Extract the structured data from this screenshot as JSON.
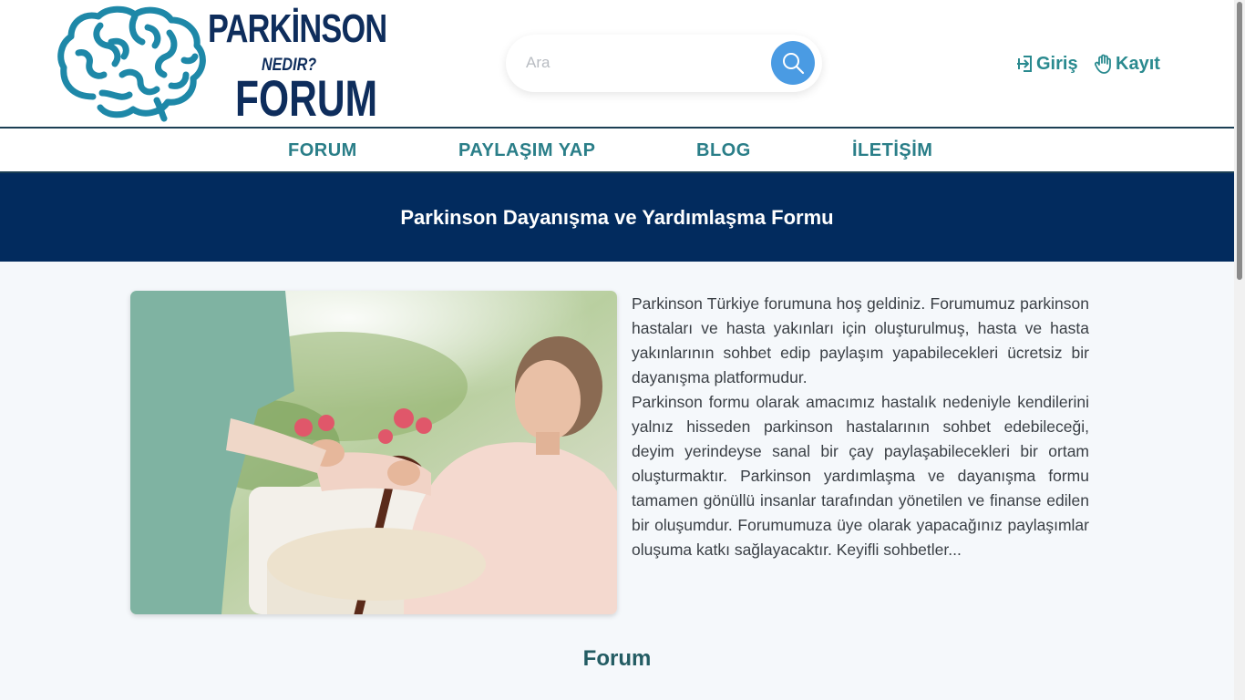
{
  "logo": {
    "line1": "PARKİNSON",
    "line2": "NEDIR?",
    "line3": "FORUM"
  },
  "search": {
    "placeholder": "Ara",
    "button_icon": "search-icon"
  },
  "auth": {
    "login_label": "Giriş",
    "register_label": "Kayıt"
  },
  "nav": {
    "items": [
      {
        "label": "FORUM"
      },
      {
        "label": "PAYLAŞIM YAP"
      },
      {
        "label": "BLOG"
      },
      {
        "label": "İLETİŞİM"
      }
    ]
  },
  "banner": {
    "title": "Parkinson Dayanışma ve Yardımlaşma Formu"
  },
  "intro": {
    "paragraph1": "Parkinson Türkiye forumuna hoş geldiniz. Forumumuz parkinson hastaları ve hasta yakınları için oluşturulmuş, hasta ve hasta yakınlarının sohbet edip paylaşım yapabilecekleri ücretsiz bir dayanışma platformudur.",
    "paragraph2": "Parkinson formu olarak amacımız hastalık nedeniyle kendilerini yalnız hisseden parkinson hastalarının sohbet edebileceği, deyim yerindeyse sanal bir çay paylaşabilecekleri bir ortam oluşturmaktır. Parkinson yardımlaşma ve dayanışma formu tamamen gönüllü insanlar tarafından yönetilen ve finanse edilen bir oluşumdur. Forumumuza üye olarak yapacağınız paylaşımlar oluşuma katkı sağlayacaktır. Keyifli sohbetler..."
  },
  "section": {
    "title": "Forum"
  },
  "colors": {
    "navy": "#022b5e",
    "teal": "#2a8a8f",
    "search_button": "#4a9be3",
    "logo_brain": "#1e88a8"
  }
}
